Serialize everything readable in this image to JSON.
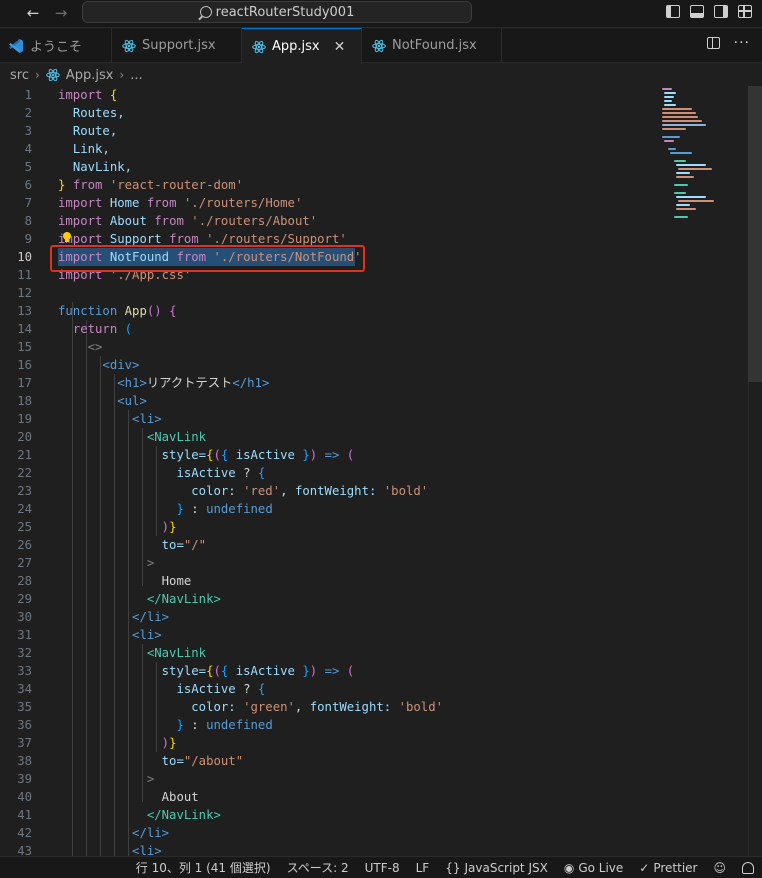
{
  "window": {
    "title": "reactRouterStudy001"
  },
  "tabs": [
    {
      "label": "ようこそ",
      "icon": "vscode-icon",
      "active": false
    },
    {
      "label": "Support.jsx",
      "icon": "react-icon",
      "active": false
    },
    {
      "label": "App.jsx",
      "icon": "react-icon",
      "active": true
    },
    {
      "label": "NotFound.jsx",
      "icon": "react-icon",
      "active": false
    }
  ],
  "breadcrumb": {
    "root": "src",
    "file": "App.jsx",
    "tail": "..."
  },
  "editor": {
    "current_line": 10,
    "line_numbers": [
      "1",
      "2",
      "3",
      "4",
      "5",
      "6",
      "7",
      "8",
      "9",
      "10",
      "11",
      "12",
      "13",
      "14",
      "15",
      "16",
      "17",
      "18",
      "19",
      "20",
      "21",
      "22",
      "23",
      "24",
      "25",
      "26",
      "27",
      "28",
      "29",
      "30",
      "31",
      "32",
      "33",
      "34",
      "35",
      "36",
      "37",
      "38",
      "39",
      "40",
      "41",
      "42",
      "43"
    ],
    "tokens": {
      "import": "import",
      "from": "from",
      "function": "function",
      "return": "return",
      "open_brace": "{",
      "close_brace": "}",
      "Routes": "Routes,",
      "Route": "Route,",
      "Link": "Link,",
      "NavLink": "NavLink,",
      "rrd": "'react-router-dom'",
      "Home": "Home",
      "homePath": "'./routers/Home'",
      "About": "About",
      "aboutPath": "'./routers/About'",
      "Support": "Support",
      "supportPath": "'./routers/Support'",
      "NotFound": "NotFound",
      "notFoundPath": "'./routers/NotFound'",
      "cssPath": "'./App.css'",
      "AppFn": "App",
      "parens": "()",
      "returnParen": "(",
      "fragOpen": "<>",
      "divOpen": "<div>",
      "h1Open": "<h1>",
      "h1Text": "リアクトテスト",
      "h1Close": "</h1>",
      "ulOpen": "<ul>",
      "liOpen": "<li>",
      "liClose": "</li>",
      "navOpen": "<NavLink",
      "navClose": "</NavLink>",
      "style": "style=",
      "isActive": "isActive",
      "arrow": "=>",
      "q": "?",
      "color": "color:",
      "red": "'red'",
      "green": "'green'",
      "fontWeight": "fontWeight:",
      "bold": "'bold'",
      "undefined": "undefined",
      "colon": ":",
      "to": "to=",
      "toHome": "\"/\"",
      "toAbout": "\"/about\"",
      "gt": ">",
      "homeText": "Home",
      "aboutText": "About"
    }
  },
  "status": {
    "position": "行 10、列 1 (41 個選択)",
    "spaces": "スペース: 2",
    "encoding": "UTF-8",
    "eol": "LF",
    "language": "JavaScript JSX",
    "golive": "Go Live",
    "prettier": "Prettier"
  },
  "colors": {
    "accent": "#0078d4",
    "annotation_box": "#e0301e",
    "selection": "#264f78"
  }
}
